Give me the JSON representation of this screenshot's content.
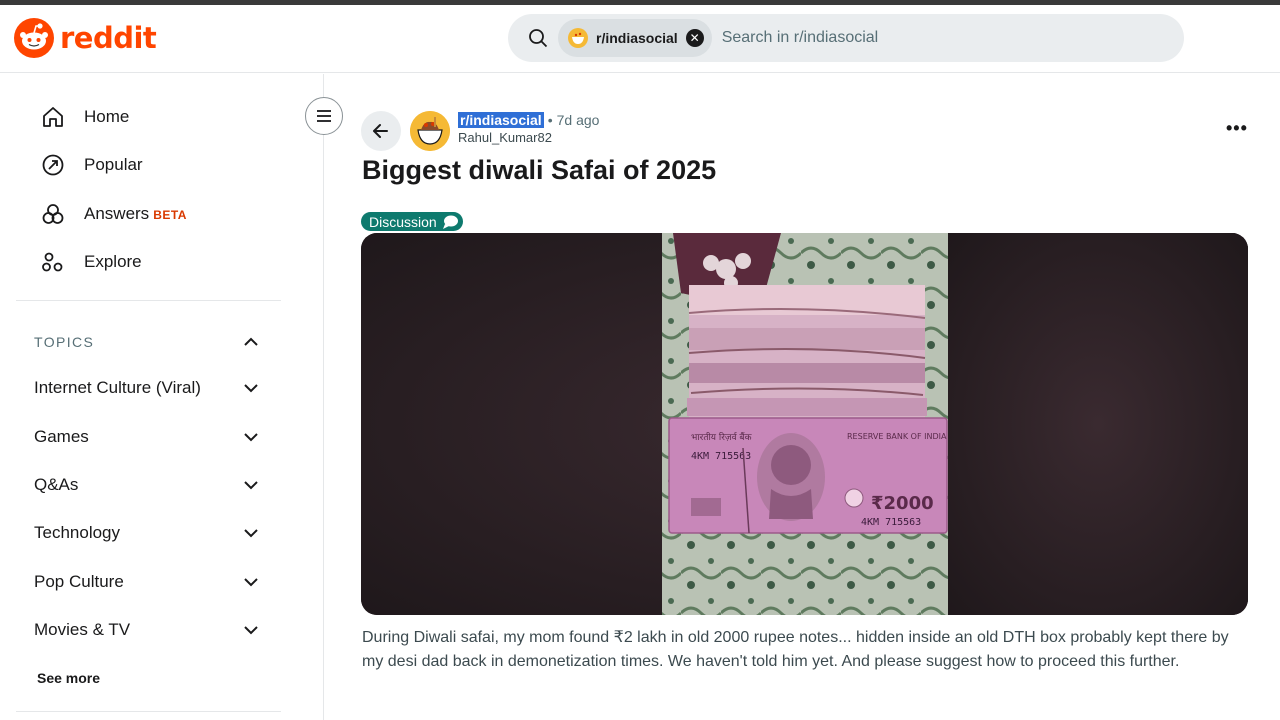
{
  "header": {
    "logo_text": "reddit",
    "search": {
      "community_chip": "r/indiasocial",
      "placeholder": "Search in r/indiasocial"
    }
  },
  "sidebar": {
    "nav": [
      {
        "label": "Home",
        "icon": "home-icon"
      },
      {
        "label": "Popular",
        "icon": "popular-icon"
      },
      {
        "label": "Answers",
        "badge": "BETA",
        "icon": "answers-icon"
      },
      {
        "label": "Explore",
        "icon": "explore-icon"
      }
    ],
    "topics_header": "TOPICS",
    "topics": [
      "Internet Culture (Viral)",
      "Games",
      "Q&As",
      "Technology",
      "Pop Culture",
      "Movies & TV"
    ],
    "see_more": "See more"
  },
  "post": {
    "subreddit": "r/indiasocial",
    "separator": "•",
    "age": "7d ago",
    "author": "Rahul_Kumar82",
    "title": "Biggest diwali Safai of 2025",
    "flair": "Discussion",
    "image_note": {
      "note_top_left": "भारतीय रिज़र्व बैंक",
      "bank_name": "RESERVE BANK OF INDIA",
      "serial_1": "4KM 715563",
      "serial_2": "4KM 715563",
      "denomination": "₹2000"
    },
    "body": "During Diwali safai, my mom found ₹2 lakh in old 2000 rupee notes... hidden inside an old DTH box probably kept there by my desi dad back in demonetization times. We haven't told him yet. And please suggest how to proceed this further."
  },
  "colors": {
    "brand": "#ff4500",
    "flair_bg": "#0e7a6e",
    "beta": "#d93900",
    "search_bg": "#eaedef"
  }
}
